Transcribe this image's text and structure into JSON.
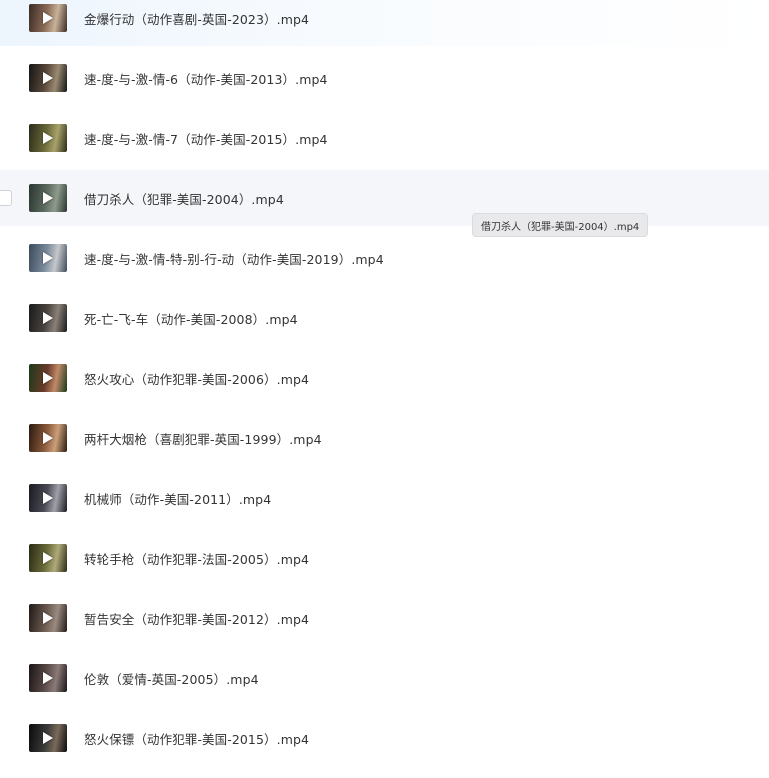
{
  "files": [
    {
      "name": "金爆行动（动作喜剧-英国-2023）.mp4",
      "thumb_colors": [
        "#3a2a24",
        "#8a6a56",
        "#c9b29a"
      ],
      "hovered": false,
      "first": true
    },
    {
      "name": "速-度-与-激-情-6（动作-美国-2013）.mp4",
      "thumb_colors": [
        "#151515",
        "#5a4a3a",
        "#9a8a72"
      ],
      "hovered": false
    },
    {
      "name": "速-度-与-激-情-7（动作-美国-2015）.mp4",
      "thumb_colors": [
        "#2b2a1a",
        "#6a6a3a",
        "#a8a26a"
      ],
      "hovered": false
    },
    {
      "name": "借刀杀人（犯罪-美国-2004）.mp4",
      "thumb_colors": [
        "#2a3530",
        "#5b6a5e",
        "#8e9a8c"
      ],
      "hovered": true
    },
    {
      "name": "速-度-与-激-情-特-别-行-动（动作-美国-2019）.mp4",
      "thumb_colors": [
        "#3a4a5a",
        "#7a8a9a",
        "#c6c8cc"
      ],
      "hovered": false
    },
    {
      "name": "死-亡-飞-车（动作-美国-2008）.mp4",
      "thumb_colors": [
        "#1a1a1a",
        "#4a4440",
        "#8a8078"
      ],
      "hovered": false
    },
    {
      "name": "怒火攻心（动作犯罪-美国-2006）.mp4",
      "thumb_colors": [
        "#1a3a1a",
        "#6a3a2a",
        "#c08a6a"
      ],
      "hovered": false
    },
    {
      "name": "两杆大烟枪（喜剧犯罪-英国-1999）.mp4",
      "thumb_colors": [
        "#2a1a10",
        "#8a5a3a",
        "#caa07a"
      ],
      "hovered": false
    },
    {
      "name": "机械师（动作-美国-2011）.mp4",
      "thumb_colors": [
        "#1a1a20",
        "#4a4a55",
        "#a0a0aa"
      ],
      "hovered": false
    },
    {
      "name": "转轮手枪（动作犯罪-法国-2005）.mp4",
      "thumb_colors": [
        "#2a2a15",
        "#6a6a3a",
        "#b0aa7a"
      ],
      "hovered": false
    },
    {
      "name": "暂告安全（动作犯罪-美国-2012）.mp4",
      "thumb_colors": [
        "#201a18",
        "#6a5a50",
        "#9a8a80"
      ],
      "hovered": false
    },
    {
      "name": "伦敦（爱情-英国-2005）.mp4",
      "thumb_colors": [
        "#1a1515",
        "#5a4a48",
        "#8a7a78"
      ],
      "hovered": false
    },
    {
      "name": "怒火保镖（动作犯罪-美国-2015）.mp4",
      "thumb_colors": [
        "#0a0a0a",
        "#3a3a3a",
        "#7a6a5a"
      ],
      "hovered": false
    }
  ],
  "tooltip": {
    "text": "借刀杀人（犯罪-美国-2004）.mp4"
  }
}
